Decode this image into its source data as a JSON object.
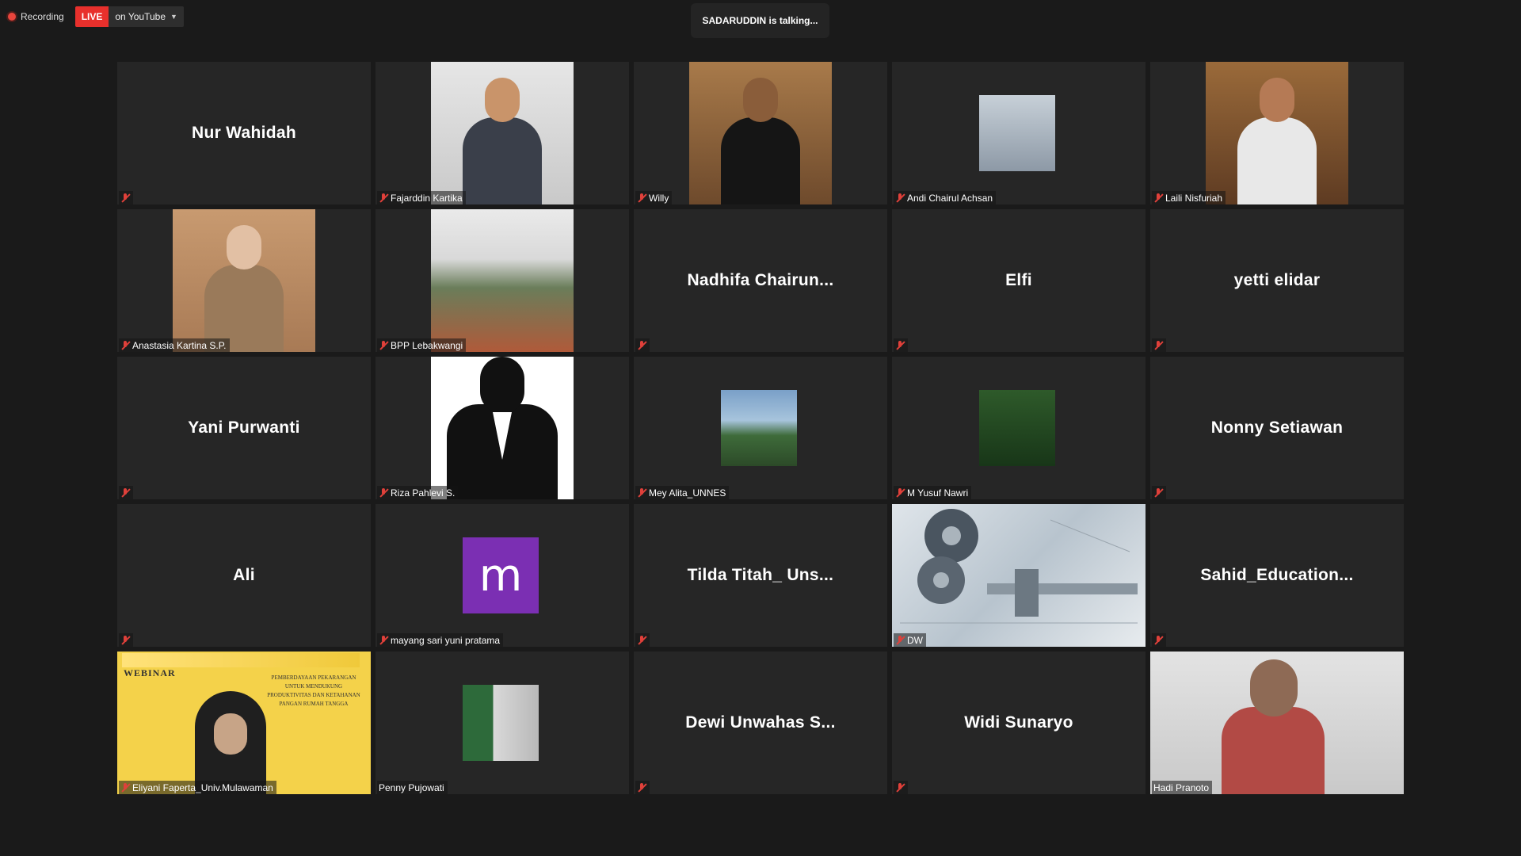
{
  "topbar": {
    "recording_label": "Recording",
    "live_label": "LIVE",
    "stream_target": "on YouTube"
  },
  "talking_indicator": "SADARUDDIN is talking...",
  "participants": [
    {
      "name": "Nur Wahidah",
      "label": "",
      "muted": true,
      "video": false
    },
    {
      "name": "",
      "label": "Fajarddin Kartika",
      "muted": true,
      "video": true
    },
    {
      "name": "",
      "label": "Willy",
      "muted": true,
      "video": true
    },
    {
      "name": "",
      "label": "Andi Chairul Achsan",
      "muted": true,
      "video": true
    },
    {
      "name": "",
      "label": "Laili Nisfuriah",
      "muted": true,
      "video": true
    },
    {
      "name": "",
      "label": "Anastasia Kartina S.P.",
      "muted": true,
      "video": true
    },
    {
      "name": "",
      "label": "BPP Lebakwangi",
      "muted": true,
      "video": true
    },
    {
      "name": "Nadhifa  Chairun...",
      "label": "",
      "muted": true,
      "video": false
    },
    {
      "name": "Elfi",
      "label": "",
      "muted": true,
      "video": false
    },
    {
      "name": "yetti elidar",
      "label": "",
      "muted": true,
      "video": false
    },
    {
      "name": "Yani Purwanti",
      "label": "",
      "muted": true,
      "video": false
    },
    {
      "name": "",
      "label": "Riza Pahlevi S.",
      "muted": true,
      "video": true
    },
    {
      "name": "",
      "label": "Mey Alita_UNNES",
      "muted": true,
      "video": true
    },
    {
      "name": "",
      "label": "M Yusuf Nawri",
      "muted": true,
      "video": true
    },
    {
      "name": "Nonny Setiawan",
      "label": "",
      "muted": true,
      "video": false
    },
    {
      "name": "Ali",
      "label": "",
      "muted": true,
      "video": false
    },
    {
      "name": "",
      "label": "mayang sari yuni pratama",
      "muted": true,
      "video": true,
      "avatar_letter": "m",
      "avatar_color": "#7b2fb3"
    },
    {
      "name": "Tilda Titah_  Uns...",
      "label": "",
      "muted": true,
      "video": false
    },
    {
      "name": "",
      "label": "DW",
      "muted": true,
      "video": true
    },
    {
      "name": "Sahid_Education...",
      "label": "",
      "muted": true,
      "video": false
    },
    {
      "name": "",
      "label": "Eliyani Faperta_Univ.Mulawaman",
      "muted": true,
      "video": true
    },
    {
      "name": "",
      "label": "Penny Pujowati",
      "muted": false,
      "video": true
    },
    {
      "name": "Dewi Unwahas S...",
      "label": "",
      "muted": true,
      "video": false
    },
    {
      "name": "Widi Sunaryo",
      "label": "",
      "muted": true,
      "video": false
    },
    {
      "name": "",
      "label": "Hadi Pranoto",
      "muted": false,
      "video": true
    }
  ],
  "webinar_slide": {
    "title": "WEBINAR",
    "text": "PEMBERDAYAAN PEKARANGAN UNTUK MENDUKUNG PRODUKTIVITAS DAN KETAHANAN PANGAN RUMAH TANGGA"
  },
  "colors": {
    "accent_live": "#e8302c",
    "muted_icon": "#e0403a",
    "tile_bg": "#262626"
  }
}
